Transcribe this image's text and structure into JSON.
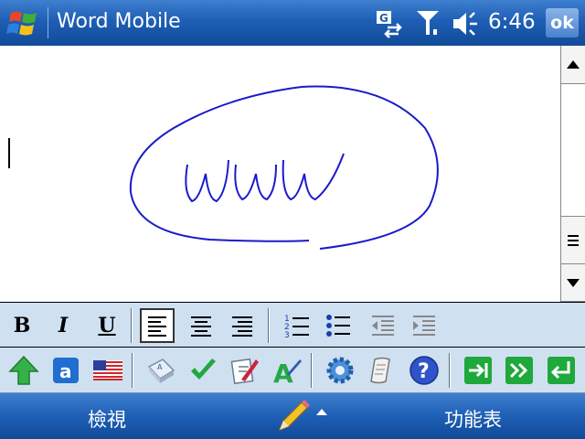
{
  "titlebar": {
    "title": "Word Mobile",
    "clock": "6:46",
    "ok_label": "ok",
    "icons": [
      "windows-flag-icon",
      "connectivity-icon",
      "signal-icon",
      "volume-icon"
    ]
  },
  "document": {
    "ink_text": "www",
    "ink_color": "#1a1acc"
  },
  "format_toolbar": {
    "bold": "B",
    "italic": "I",
    "underline": "U",
    "selected": "align-left"
  },
  "input_toolbar": {
    "icons": [
      "shift-up-icon",
      "letter-a-icon",
      "us-flag-icon",
      "keyboard-icon",
      "check-icon",
      "correction-icon",
      "recognize-icon",
      "settings-icon",
      "scroll-icon",
      "help-icon",
      "tab-icon",
      "space-icon",
      "enter-icon"
    ],
    "letter_a": "a",
    "help_mark": "?"
  },
  "softkeys": {
    "left": "檢視",
    "right": "功能表"
  },
  "colors": {
    "titlebar": "#1e5fb5",
    "toolbar_bg": "#cfe0f1",
    "accent_green": "#19a83a"
  }
}
